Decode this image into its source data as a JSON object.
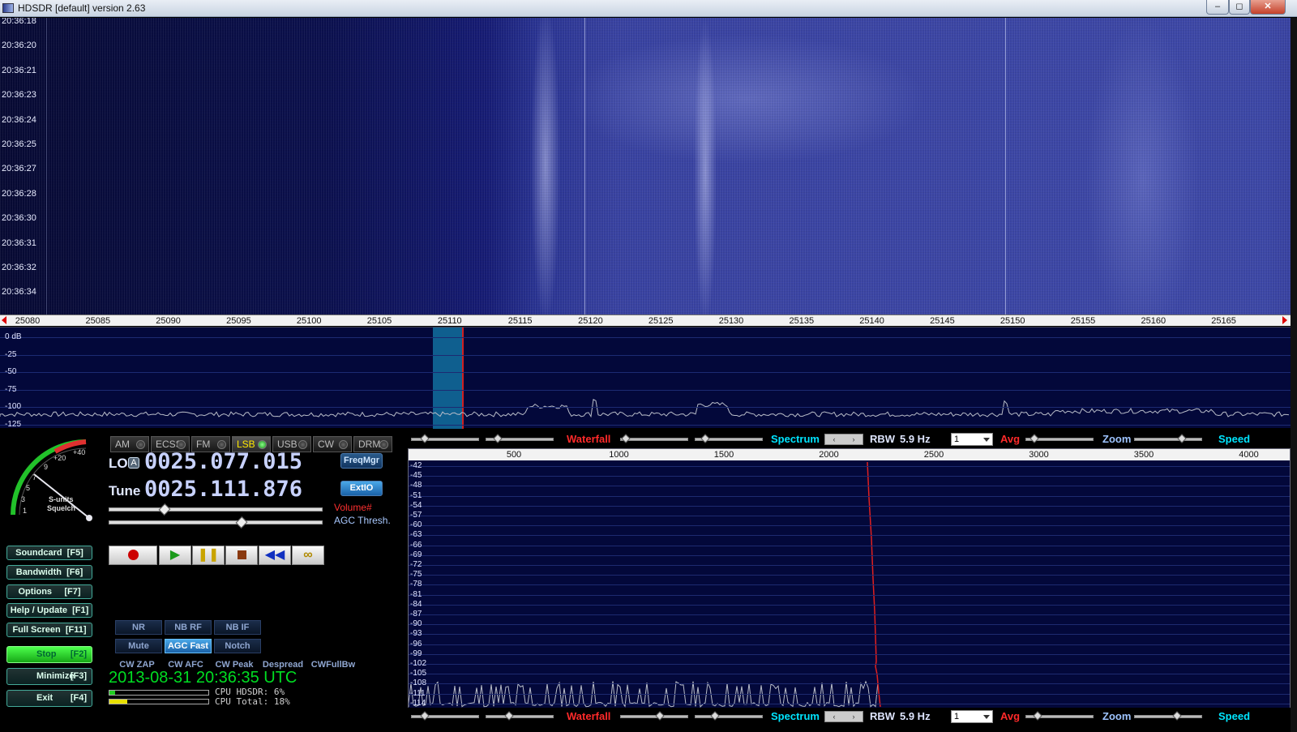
{
  "window": {
    "title": "HDSDR [default]  version 2.63",
    "controls": [
      "–",
      "◻",
      "✕"
    ]
  },
  "waterfall": {
    "times": [
      "20:36:18",
      "20:36:20",
      "20:36:21",
      "20:36:23",
      "20:36:24",
      "20:36:25",
      "20:36:27",
      "20:36:28",
      "20:36:30",
      "20:36:31",
      "20:36:32",
      "20:36:34"
    ],
    "freq_ticks": [
      "25080",
      "25085",
      "25090",
      "25095",
      "25100",
      "25105",
      "25110",
      "25115",
      "25120",
      "25125",
      "25130",
      "25135",
      "25140",
      "25145",
      "25150",
      "25155",
      "25160",
      "25165"
    ]
  },
  "spectrum": {
    "db_labels": [
      "0 dB",
      "-25",
      "-50",
      "-75",
      "-100",
      "-125"
    ]
  },
  "mode_buttons": [
    {
      "label": "AM",
      "active": false
    },
    {
      "label": "ECSS",
      "active": false
    },
    {
      "label": "FM",
      "active": false
    },
    {
      "label": "LSB",
      "active": true
    },
    {
      "label": "USB",
      "active": false
    },
    {
      "label": "CW",
      "active": false
    },
    {
      "label": "DRM",
      "active": false
    }
  ],
  "lo": {
    "label": "LO",
    "badge": "A",
    "value": "0025.077.015"
  },
  "tune": {
    "label": "Tune",
    "value": "0025.111.876"
  },
  "freqmgr_label": "FreqMgr",
  "extio_label": "ExtIO",
  "volume_label": "Volume#",
  "agc_thresh_label": "AGC Thresh.",
  "volume_level": 0.24,
  "agc_level": 0.6,
  "s_meter": {
    "scale": [
      "1",
      "3",
      "5",
      "7",
      "9",
      "+20",
      "+40"
    ],
    "caption_1": "S-units",
    "caption_2": "Squelch"
  },
  "side_buttons": [
    {
      "label": "Soundcard  [F5]"
    },
    {
      "label": "Bandwidth  [F6]"
    },
    {
      "label": "Options     [F7]"
    },
    {
      "label": "Help / Update  [F1]"
    },
    {
      "label": "Full Screen  [F11]"
    }
  ],
  "bottom_buttons": [
    {
      "label": "Stop",
      "key": "[F2]",
      "active": true
    },
    {
      "label": "Minimize",
      "key": "[F3]",
      "active": false
    },
    {
      "label": "Exit",
      "key": "[F4]",
      "active": false
    }
  ],
  "transport": [
    "record-icon",
    "play-icon",
    "pause-icon",
    "stop-icon",
    "rewind-icon",
    "loop-icon"
  ],
  "dsp_row1": [
    {
      "label": "NR",
      "active": false
    },
    {
      "label": "NB RF",
      "active": false
    },
    {
      "label": "NB IF",
      "active": false
    }
  ],
  "dsp_row2": [
    {
      "label": "Mute",
      "active": false
    },
    {
      "label": "AGC Fast",
      "active": true
    },
    {
      "label": "Notch",
      "active": false
    }
  ],
  "dsp_row3": [
    {
      "label": "CW ZAP"
    },
    {
      "label": "CW AFC"
    },
    {
      "label": "CW Peak"
    },
    {
      "label": "Despread"
    },
    {
      "label": "CWFullBw"
    }
  ],
  "datetime": "2013-08-31   20:36:35 UTC",
  "cpu": {
    "hdsdr_label": "CPU HDSDR:  6%",
    "total_label": "CPU Total: 18%",
    "hdsdr_percent": 6,
    "total_percent": 18
  },
  "ctrl_row": {
    "waterfall": "Waterfall",
    "spectrum": "Spectrum",
    "rbw": "RBW",
    "rbw_value": "5.9 Hz",
    "avg_value": "1",
    "avg": "Avg",
    "zoom": "Zoom",
    "speed": "Speed"
  },
  "audio": {
    "freq_ticks": [
      "500",
      "1000",
      "1500",
      "2000",
      "2500",
      "3000",
      "3500",
      "4000"
    ],
    "db_labels": [
      "-42",
      "-45",
      "-48",
      "-51",
      "-54",
      "-57",
      "-60",
      "-63",
      "-66",
      "-69",
      "-72",
      "-75",
      "-78",
      "-81",
      "-84",
      "-87",
      "-90",
      "-93",
      "-96",
      "-99",
      "-102",
      "-105",
      "-108",
      "-111",
      "-114",
      "-117"
    ]
  },
  "colors": {
    "accent_green": "#00dd22",
    "stop_green": "#2bd42b",
    "waterfall_blue": "#3d47a9",
    "spectrum_bg": "#03083a",
    "marker_red": "#d02020"
  }
}
